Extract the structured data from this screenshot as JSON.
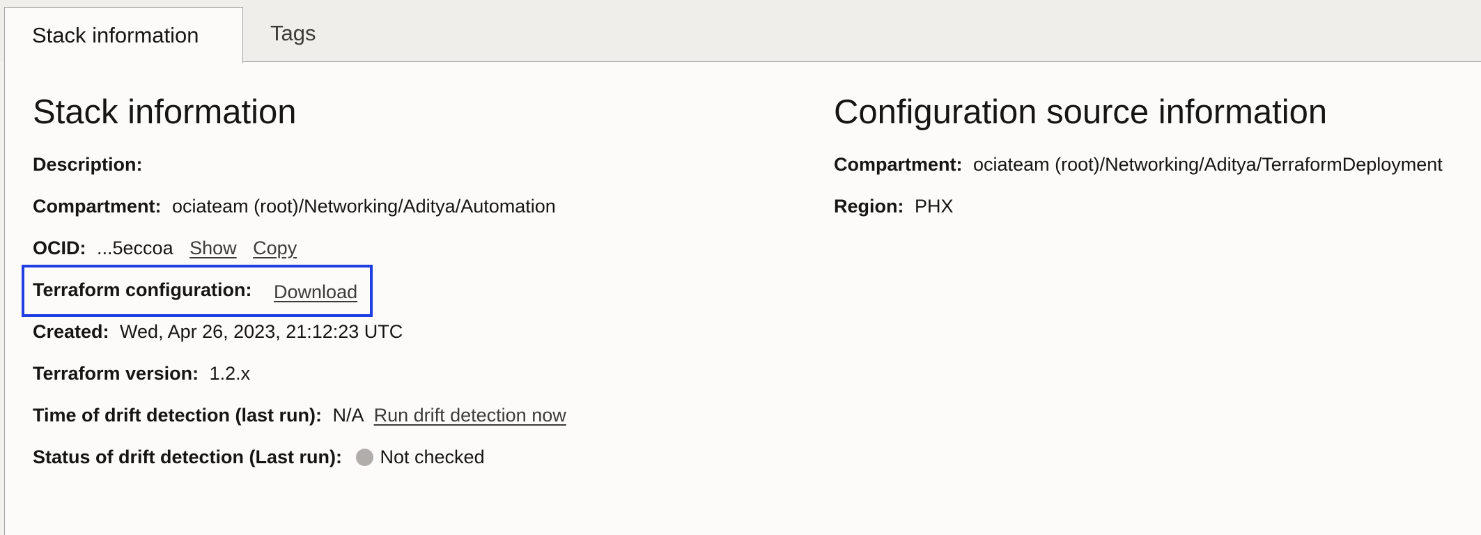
{
  "tabs": [
    {
      "label": "Stack information",
      "active": true
    },
    {
      "label": "Tags",
      "active": false
    }
  ],
  "stack_info": {
    "heading": "Stack information",
    "description_label": "Description:",
    "description_value": "",
    "compartment_label": "Compartment:",
    "compartment_value": "ociateam (root)/Networking/Aditya/Automation",
    "ocid_label": "OCID:",
    "ocid_value": "...5eccoa",
    "ocid_show": "Show",
    "ocid_copy": "Copy",
    "tf_config_label": "Terraform configuration:",
    "tf_config_download": "Download",
    "created_label": "Created:",
    "created_value": "Wed, Apr 26, 2023, 21:12:23 UTC",
    "tf_version_label": "Terraform version:",
    "tf_version_value": "1.2.x",
    "drift_time_label": "Time of drift detection (last run):",
    "drift_time_value": "N/A",
    "drift_run_link": "Run drift detection now",
    "drift_status_label": "Status of drift detection (Last run):",
    "drift_status_value": "Not checked",
    "drift_status_icon": "status-dot-icon",
    "drift_status_color": "#b0adaa"
  },
  "config_source": {
    "heading": "Configuration source information",
    "compartment_label": "Compartment:",
    "compartment_value": "ociateam (root)/Networking/Aditya/TerraformDeployment",
    "region_label": "Region:",
    "region_value": "PHX"
  },
  "highlight_color": "#1f3fe0"
}
